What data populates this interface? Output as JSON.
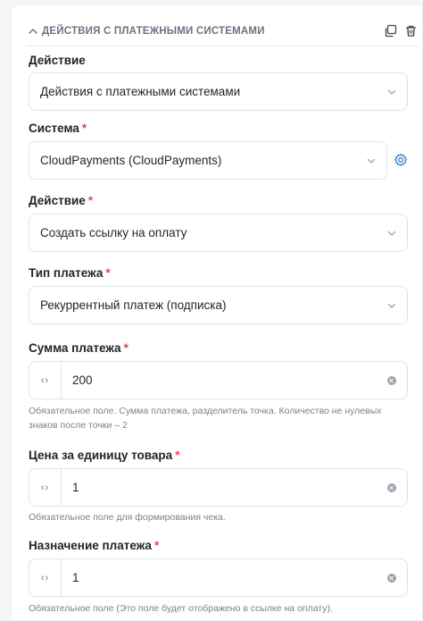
{
  "section": {
    "title": "ДЕЙСТВИЯ С ПЛАТЕЖНЫМИ СИСТЕМАМИ",
    "icons": [
      "chevron-up-icon",
      "copy-icon",
      "trash-icon"
    ]
  },
  "fields": {
    "action_type": {
      "label": "Действие",
      "value": "Действия с платежными системами"
    },
    "system": {
      "label": "Система",
      "required_mark": "*",
      "value": "CloudPayments (CloudPayments)"
    },
    "action": {
      "label": "Действие",
      "required_mark": "*",
      "value": "Создать ссылку на оплату"
    },
    "payment_type": {
      "label": "Тип платежа",
      "required_mark": "*",
      "value": "Рекуррентный платеж (подписка)"
    },
    "amount": {
      "label": "Сумма платежа",
      "required_mark": "*",
      "code_toggle": "‹›",
      "value": "200",
      "hint": "Обязательное поле. Сумма платежа, разделитель точка. Количество не нулевых знаков после точки – 2"
    },
    "unit_price": {
      "label": "Цена за единицу товара",
      "required_mark": "*",
      "code_toggle": "‹›",
      "value": "1",
      "hint": "Обязательное поле для формирования чека."
    },
    "purpose": {
      "label": "Назначение платежа",
      "required_mark": "*",
      "code_toggle": "‹›",
      "value": "1",
      "hint": "Обязательное поле (Это поле будет отображено в ссылке на оплату)."
    }
  },
  "colors": {
    "required": "#e5484d",
    "gear_accent": "#2b7fd4",
    "border": "#dfe2e6"
  }
}
